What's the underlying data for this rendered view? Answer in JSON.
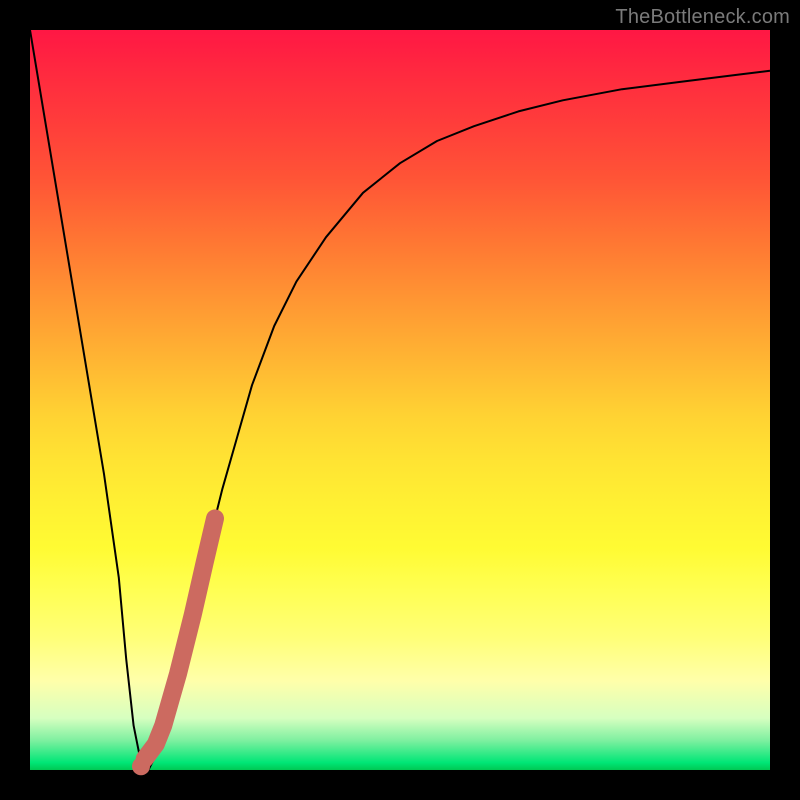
{
  "watermark": "TheBottleneck.com",
  "colors": {
    "frame": "#000000",
    "curve": "#000000",
    "marker": "#cc6a60",
    "gradient_stops": [
      "#ff1744",
      "#ff2a3f",
      "#ff3b3b",
      "#ff5436",
      "#ff7433",
      "#ff9433",
      "#ffb333",
      "#ffd233",
      "#ffe333",
      "#fff033",
      "#fffb33",
      "#ffff55",
      "#ffff77",
      "#ffffaa",
      "#d6ffc0",
      "#7ef0a0",
      "#00e676",
      "#00c853"
    ]
  },
  "chart_data": {
    "type": "line",
    "title": "",
    "xlabel": "",
    "ylabel": "",
    "xlim": [
      0,
      100
    ],
    "ylim": [
      0,
      100
    ],
    "series": [
      {
        "name": "bottleneck-curve",
        "x": [
          0,
          2,
          4,
          6,
          8,
          10,
          12,
          13,
          14,
          15,
          16,
          18,
          20,
          22,
          24,
          26,
          28,
          30,
          33,
          36,
          40,
          45,
          50,
          55,
          60,
          66,
          72,
          80,
          88,
          96,
          100
        ],
        "y": [
          100,
          88,
          76,
          64,
          52,
          40,
          26,
          15,
          6,
          1,
          0,
          4,
          13,
          22,
          30,
          38,
          45,
          52,
          60,
          66,
          72,
          78,
          82,
          85,
          87,
          89,
          90.5,
          92,
          93,
          94,
          94.5
        ]
      }
    ],
    "markers": {
      "name": "highlight-segment",
      "points": [
        {
          "x": 15.5,
          "y": 1.5
        },
        {
          "x": 17.0,
          "y": 3.5
        },
        {
          "x": 18.0,
          "y": 6.0
        },
        {
          "x": 19.0,
          "y": 9.5
        },
        {
          "x": 20.0,
          "y": 13.0
        },
        {
          "x": 21.0,
          "y": 17.0
        },
        {
          "x": 22.0,
          "y": 21.0
        },
        {
          "x": 22.8,
          "y": 24.5
        },
        {
          "x": 23.6,
          "y": 28.0
        },
        {
          "x": 24.3,
          "y": 31.0
        },
        {
          "x": 25.0,
          "y": 34.0
        }
      ]
    }
  }
}
